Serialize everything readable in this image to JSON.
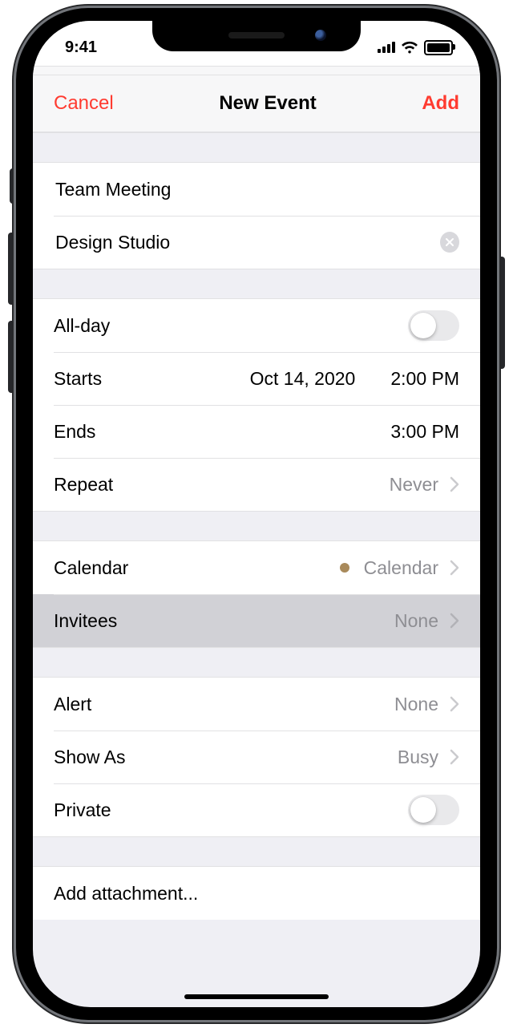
{
  "status": {
    "time": "9:41"
  },
  "nav": {
    "cancel": "Cancel",
    "title": "New Event",
    "add": "Add"
  },
  "event": {
    "title": "Team Meeting",
    "location": "Design Studio",
    "allday_label": "All-day",
    "starts_label": "Starts",
    "starts_date": "Oct 14, 2020",
    "starts_time": "2:00 PM",
    "ends_label": "Ends",
    "ends_time": "3:00 PM",
    "repeat_label": "Repeat",
    "repeat_value": "Never",
    "calendar_label": "Calendar",
    "calendar_value": "Calendar",
    "invitees_label": "Invitees",
    "invitees_value": "None",
    "alert_label": "Alert",
    "alert_value": "None",
    "showas_label": "Show As",
    "showas_value": "Busy",
    "private_label": "Private",
    "attachment_label": "Add attachment..."
  }
}
